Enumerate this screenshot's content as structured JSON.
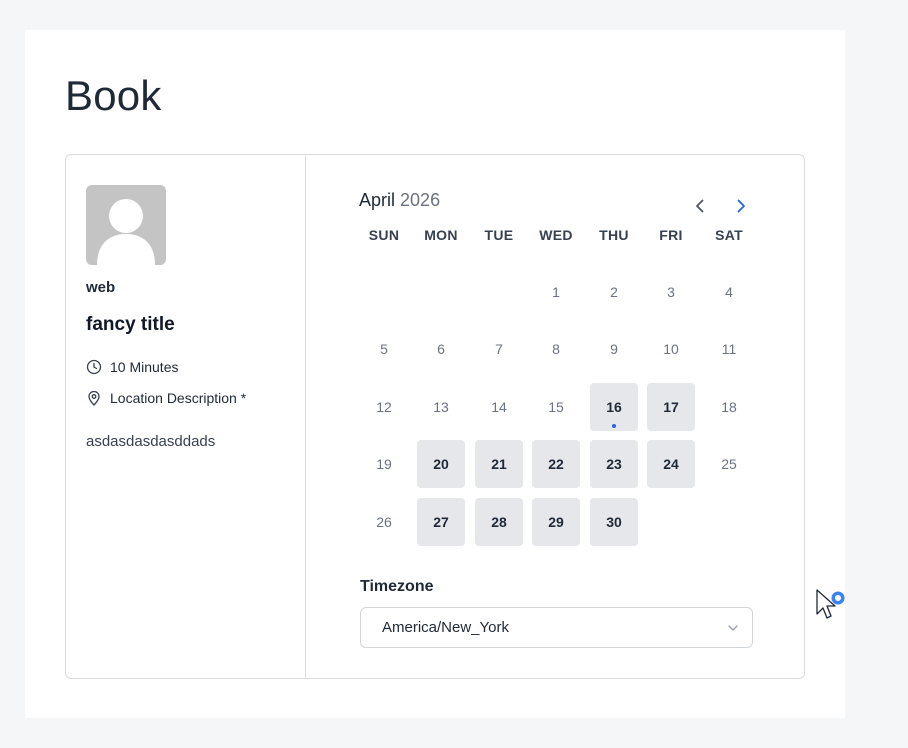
{
  "page": {
    "title": "Book"
  },
  "host": {
    "name": "web"
  },
  "event": {
    "title": "fancy title",
    "duration": "10 Minutes",
    "location": "Location Description *",
    "description": "asdasdasdasddads"
  },
  "calendar": {
    "month": "April",
    "year": "2026",
    "weekdays": [
      "SUN",
      "MON",
      "TUE",
      "WED",
      "THU",
      "FRI",
      "SAT"
    ],
    "first_weekday_index": 3,
    "days_in_month": 30,
    "available_days": [
      16,
      17,
      20,
      21,
      22,
      23,
      24,
      27,
      28,
      29,
      30
    ],
    "today": 16
  },
  "timezone": {
    "label": "Timezone",
    "value": "America/New_York"
  },
  "colors": {
    "accent": "#2563eb",
    "available_bg": "#e5e7eb",
    "border": "#d9dce1",
    "cursor_ring": "#3b82f6"
  },
  "icons": {
    "prev": "chevron-left-icon",
    "next": "chevron-right-icon",
    "duration": "clock-icon",
    "location": "map-pin-icon",
    "select": "chevron-down-icon"
  }
}
